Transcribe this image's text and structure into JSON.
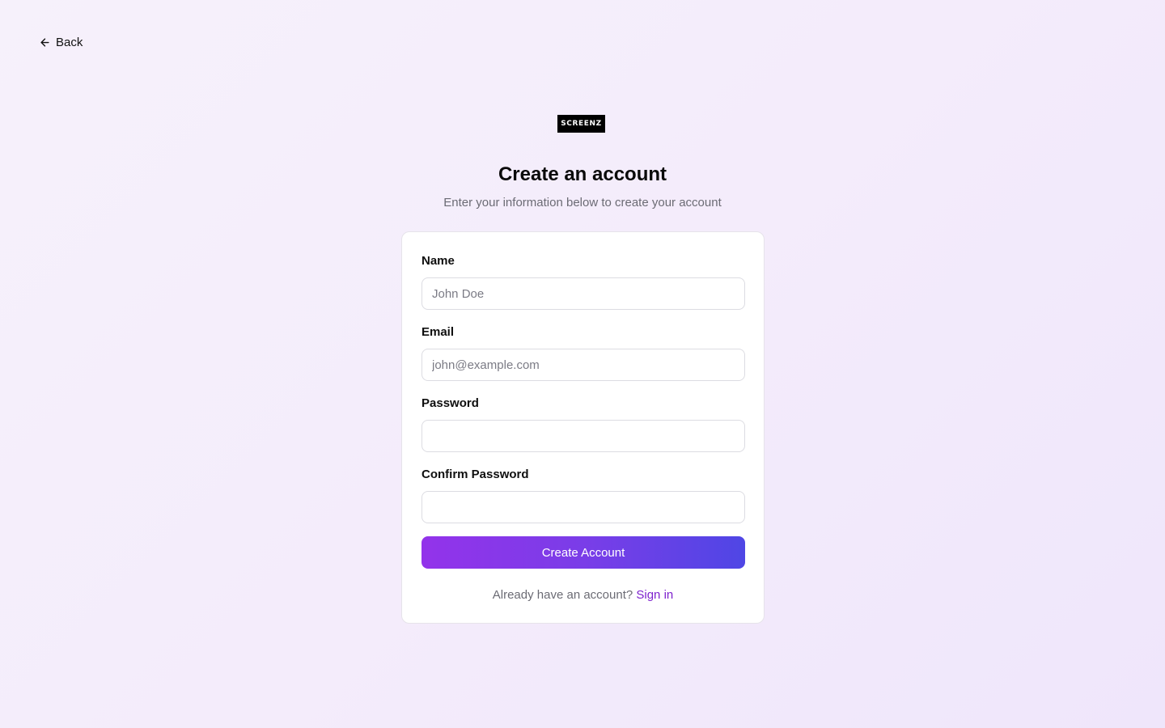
{
  "nav": {
    "back_label": "Back",
    "back_icon": "arrow-left-icon"
  },
  "brand": {
    "logo_text": "SCREENZ"
  },
  "header": {
    "title": "Create an account",
    "subtitle": "Enter your information below to create your account"
  },
  "form": {
    "name": {
      "label": "Name",
      "placeholder": "John Doe",
      "value": ""
    },
    "email": {
      "label": "Email",
      "placeholder": "john@example.com",
      "value": ""
    },
    "password": {
      "label": "Password",
      "placeholder": "",
      "value": ""
    },
    "confirm_password": {
      "label": "Confirm Password",
      "placeholder": "",
      "value": ""
    },
    "submit_label": "Create Account"
  },
  "footer": {
    "prompt": "Already have an account?",
    "signin_label": "Sign in"
  },
  "colors": {
    "accent_start": "#9333ea",
    "accent_end": "#4f46e5",
    "link": "#7e22ce"
  }
}
